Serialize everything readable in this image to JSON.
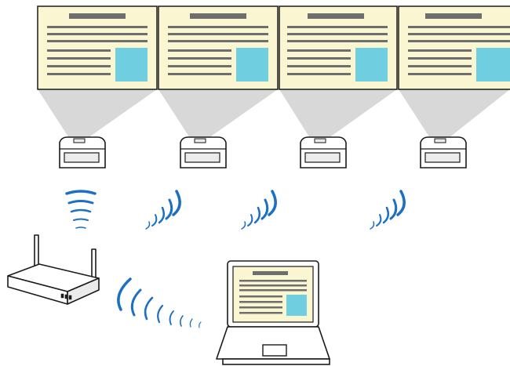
{
  "diagram": {
    "colors": {
      "screen_bg": "#fbf6d2",
      "outline": "#1a1a1a",
      "text_lines": "#6e6e6e",
      "image_box": "#6fcfe0",
      "beam": "#d8d8d8",
      "wifi": "#1b6fc4",
      "device_body": "#ffffff",
      "device_shade": "#ebebeb"
    },
    "icons": {
      "screens": [
        "document-screen-icon",
        "document-screen-icon",
        "document-screen-icon",
        "document-screen-icon"
      ],
      "projectors": [
        "projector-icon",
        "projector-icon",
        "projector-icon",
        "projector-icon"
      ],
      "router": "wireless-router-icon",
      "laptop": "laptop-icon",
      "signals": "wifi-signal-icon"
    }
  }
}
